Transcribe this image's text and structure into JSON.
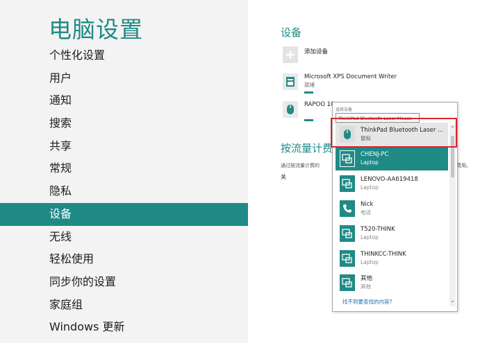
{
  "left": {
    "title": "电脑设置",
    "nav_items": [
      {
        "label": "个性化设置"
      },
      {
        "label": "用户"
      },
      {
        "label": "通知"
      },
      {
        "label": "搜索"
      },
      {
        "label": "共享"
      },
      {
        "label": "常规"
      },
      {
        "label": "隐私"
      },
      {
        "label": "设备"
      },
      {
        "label": "无线"
      },
      {
        "label": "轻松使用"
      },
      {
        "label": "同步你的设置"
      },
      {
        "label": "家庭组"
      },
      {
        "label": "Windows 更新"
      }
    ],
    "active_item": "设备"
  },
  "right": {
    "section_title": "设备",
    "add_device": "添加设备",
    "devices": [
      {
        "name": "Microsoft XPS Document Writer",
        "status": "就绪",
        "icon": "printer-icon"
      },
      {
        "name": "RAPOO 10",
        "status": "",
        "icon": "mouse-icon"
      }
    ],
    "metered_title": "按流量计费",
    "metered_desc": "通过按流量计费的",
    "metered_desc_tail": "费用。",
    "metered_toggle": "关"
  },
  "popup": {
    "header": "选择设备",
    "tooltip": "ThinkPad Bluetooth Laser Mouse",
    "items": [
      {
        "name": "ThinkPad Bluetooth Laser ...",
        "type": "鼠标",
        "icon": "mouse-icon",
        "state": "first"
      },
      {
        "name": "CHENJ-PC",
        "type": "Laptop",
        "icon": "laptop-icon",
        "state": "selected"
      },
      {
        "name": "LENOVO-AA619418",
        "type": "Laptop",
        "icon": "laptop-icon",
        "state": "normal"
      },
      {
        "name": "Nick",
        "type": "电话",
        "icon": "phone-icon",
        "state": "normal"
      },
      {
        "name": "T520-THINK",
        "type": "Laptop",
        "icon": "laptop-icon",
        "state": "normal"
      },
      {
        "name": "THINKCC-THINK",
        "type": "Laptop",
        "icon": "laptop-icon",
        "state": "normal"
      },
      {
        "name": "其他",
        "type": "其他",
        "icon": "laptop-icon",
        "state": "normal"
      }
    ],
    "link": "找不到要查找的内容?"
  },
  "colors": {
    "accent": "#1f8a86",
    "highlight": "#d5262e",
    "link": "#1f6fb5"
  }
}
